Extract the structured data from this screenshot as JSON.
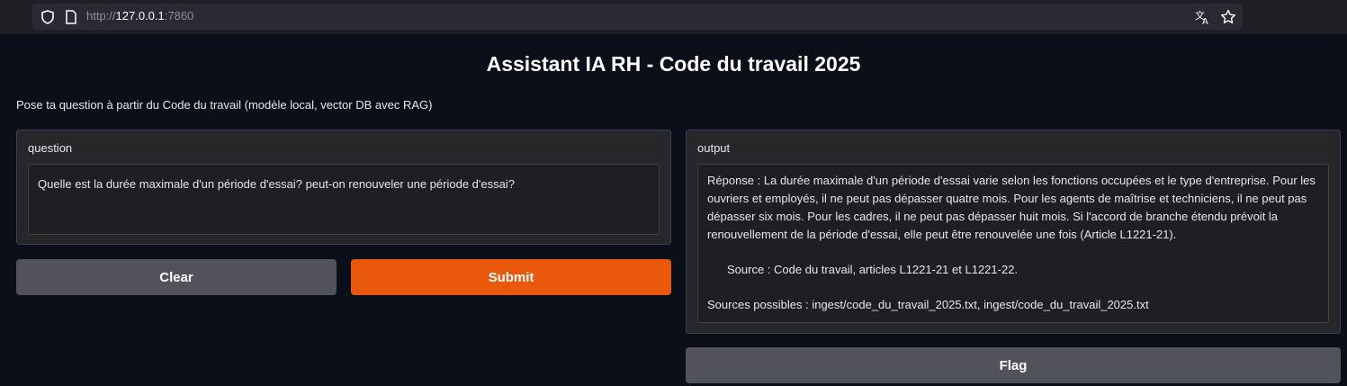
{
  "browser": {
    "url_prefix": "http://",
    "url_host": "127.0.0.1",
    "url_port": ":7860"
  },
  "app": {
    "title": "Assistant IA RH - Code du travail 2025",
    "description": "Pose ta question à partir du Code du travail (modèle local, vector DB avec RAG)"
  },
  "question": {
    "label": "question",
    "value": "Quelle est la durée maximale d'un période d'essai? peut-on renouveler une période d'essai?"
  },
  "output": {
    "label": "output",
    "answer": "Réponse : La durée maximale d'un période d'essai varie selon les fonctions occupées et le type d'entreprise. Pour les ouvriers et employés, il ne peut pas dépasser quatre mois. Pour les agents de maîtrise et techniciens, il ne peut pas dépasser six mois. Pour les cadres, il ne peut pas dépasser huit mois. Si l'accord de branche étendu prévoit la renouvellement de la période d'essai, elle peut être renouvelée une fois (Article L1221-21).",
    "source": "Source : Code du travail, articles L1221-21 et L1221-22.",
    "possible_sources": "Sources possibles : ingest/code_du_travail_2025.txt, ingest/code_du_travail_2025.txt"
  },
  "buttons": {
    "clear": "Clear",
    "submit": "Submit",
    "flag": "Flag"
  },
  "colors": {
    "accent": "#ea580c",
    "secondary_button": "#52525b",
    "background": "#0b0f19"
  }
}
